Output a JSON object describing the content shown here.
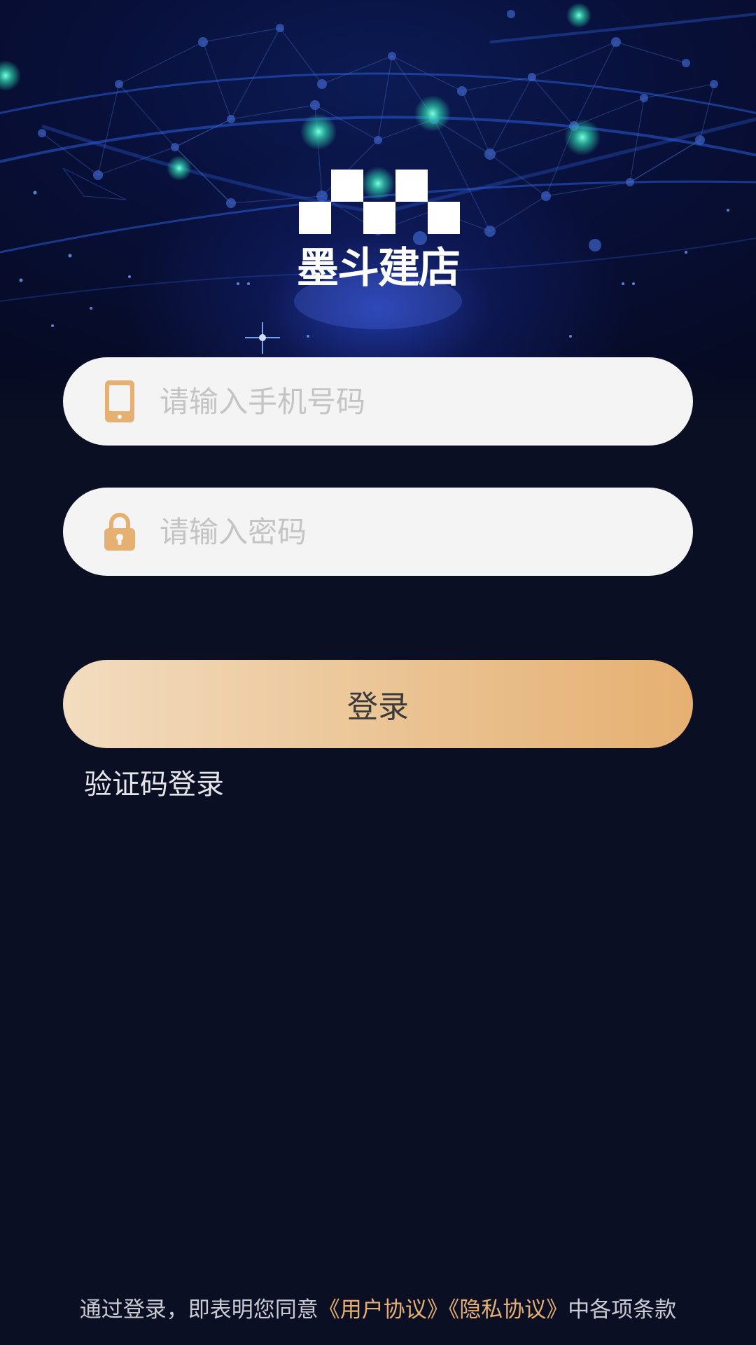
{
  "app": {
    "brand_name": "墨斗建店"
  },
  "login_form": {
    "phone_placeholder": "请输入手机号码",
    "phone_value": "",
    "password_placeholder": "请输入密码",
    "password_value": "",
    "login_label": "登录",
    "sms_login_label": "验证码登录"
  },
  "footer": {
    "prefix": "通过登录，即表明您同意",
    "user_agreement": "《用户协议》",
    "privacy_agreement": "《隐私协议》",
    "suffix": "中各项条款"
  },
  "icons": {
    "phone": "phone-icon",
    "lock": "lock-icon"
  },
  "colors": {
    "background": "#0b0f24",
    "accent": "#e6b072",
    "input_background": "#f4f4f4",
    "placeholder": "#c4c4c4"
  }
}
